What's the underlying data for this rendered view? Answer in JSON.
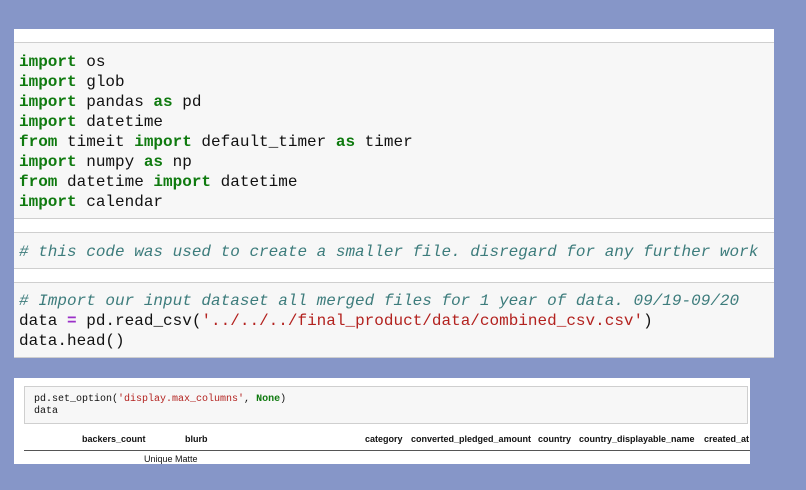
{
  "notebook_top": {
    "cell_imports": {
      "lines": [
        [
          {
            "t": "import",
            "c": "kw"
          },
          {
            "t": " os",
            "c": ""
          }
        ],
        [
          {
            "t": "import",
            "c": "kw"
          },
          {
            "t": " glob",
            "c": ""
          }
        ],
        [
          {
            "t": "import",
            "c": "kw"
          },
          {
            "t": " pandas ",
            "c": ""
          },
          {
            "t": "as",
            "c": "kw"
          },
          {
            "t": " pd",
            "c": ""
          }
        ],
        [
          {
            "t": "import",
            "c": "kw"
          },
          {
            "t": " datetime",
            "c": ""
          }
        ],
        [
          {
            "t": "from",
            "c": "kw"
          },
          {
            "t": " timeit ",
            "c": ""
          },
          {
            "t": "import",
            "c": "kw"
          },
          {
            "t": " default_timer ",
            "c": ""
          },
          {
            "t": "as",
            "c": "kw"
          },
          {
            "t": " timer",
            "c": ""
          }
        ],
        [
          {
            "t": "import",
            "c": "kw"
          },
          {
            "t": " numpy ",
            "c": ""
          },
          {
            "t": "as",
            "c": "kw"
          },
          {
            "t": " np",
            "c": ""
          }
        ],
        [
          {
            "t": "from",
            "c": "kw"
          },
          {
            "t": " datetime ",
            "c": ""
          },
          {
            "t": "import",
            "c": "kw"
          },
          {
            "t": " datetime",
            "c": ""
          }
        ],
        [
          {
            "t": "import",
            "c": "kw"
          },
          {
            "t": " calendar",
            "c": ""
          }
        ]
      ]
    },
    "cell_comment": {
      "lines": [
        [
          {
            "t": "# this code was used to create a smaller file. disregard for any further work",
            "c": "cm"
          }
        ]
      ]
    },
    "cell_read": {
      "lines": [
        [
          {
            "t": "# Import our input dataset all merged files for 1 year of data. 09/19-09/20",
            "c": "cm"
          }
        ],
        [
          {
            "t": "data ",
            "c": ""
          },
          {
            "t": "=",
            "c": "op"
          },
          {
            "t": " pd.read_csv(",
            "c": ""
          },
          {
            "t": "'../../../final_product/data/combined_csv.csv'",
            "c": "str"
          },
          {
            "t": ")",
            "c": ""
          }
        ],
        [
          {
            "t": "data.head()",
            "c": ""
          }
        ]
      ]
    }
  },
  "notebook_bottom": {
    "cell_options": {
      "lines": [
        [
          {
            "t": "pd.set_option(",
            "c": ""
          },
          {
            "t": "'display.max_columns'",
            "c": "str"
          },
          {
            "t": ", ",
            "c": ""
          },
          {
            "t": "None",
            "c": "kw"
          },
          {
            "t": ")",
            "c": ""
          }
        ],
        [
          {
            "t": "data",
            "c": ""
          }
        ]
      ]
    },
    "dataframe": {
      "columns": [
        "backers_count",
        "blurb",
        "category",
        "converted_pledged_amount",
        "country",
        "country_displayable_name",
        "created_at"
      ],
      "first_row_blurb": "Unique Matte"
    }
  }
}
